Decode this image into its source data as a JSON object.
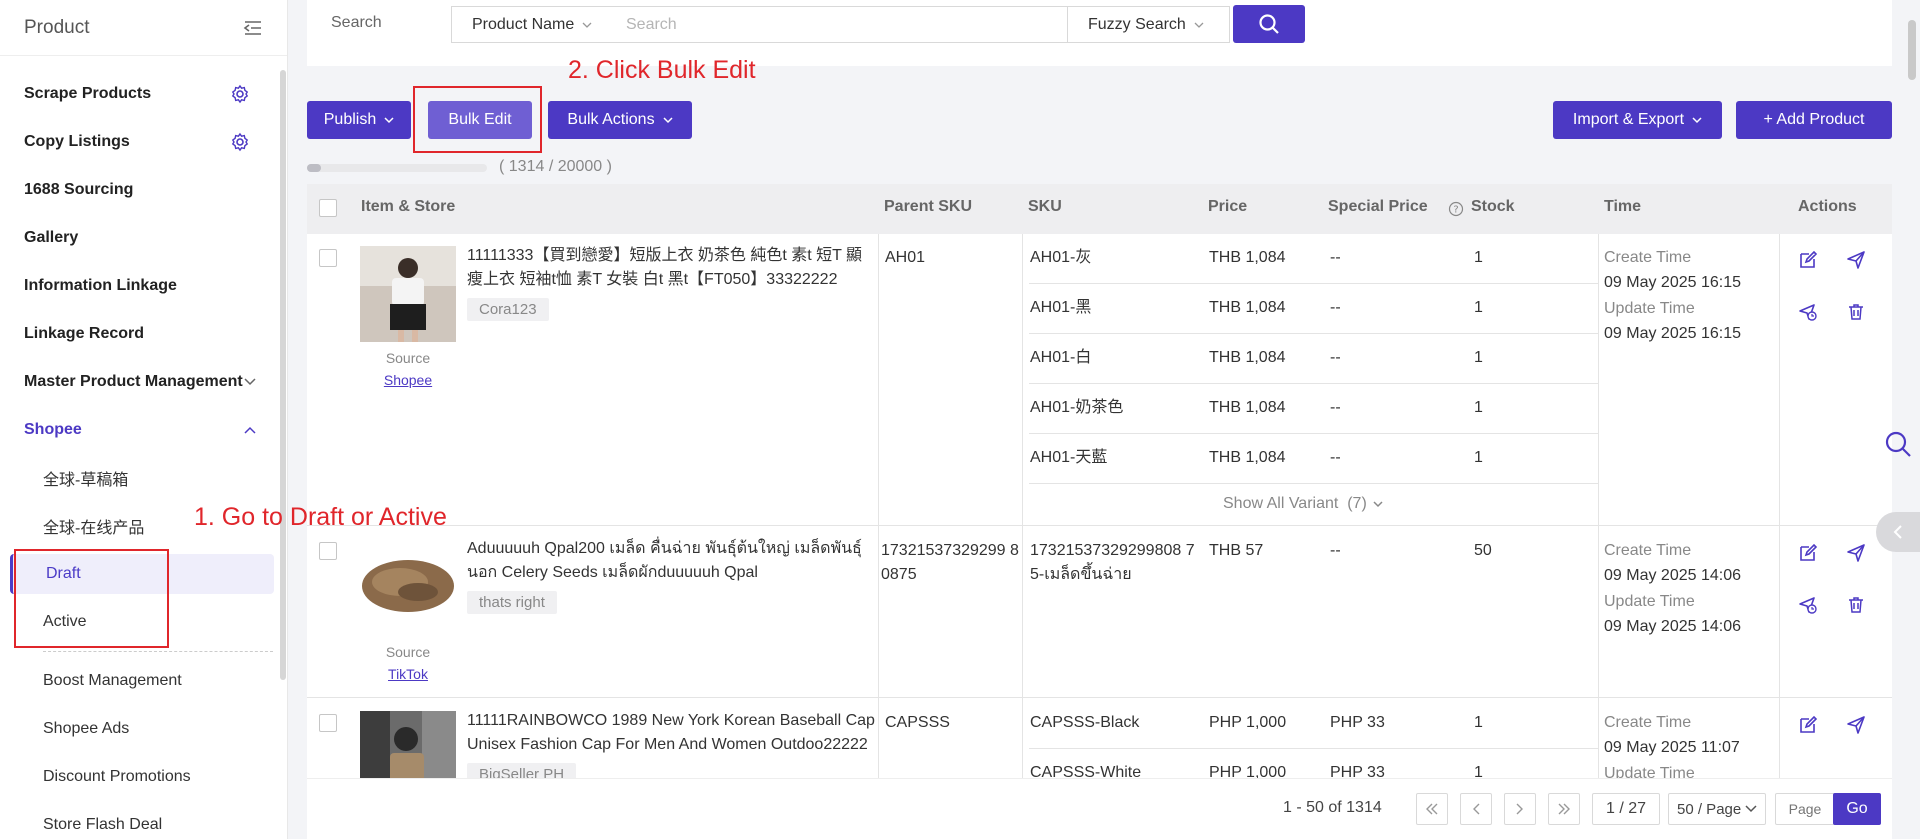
{
  "sidebar": {
    "title": "Product",
    "items": [
      {
        "label": "Scrape Products"
      },
      {
        "label": "Copy Listings"
      },
      {
        "label": "1688 Sourcing"
      },
      {
        "label": "Gallery"
      },
      {
        "label": "Information Linkage"
      },
      {
        "label": "Linkage Record"
      },
      {
        "label": "Master Product Management"
      },
      {
        "label": "Shopee"
      }
    ],
    "shopee_sub": [
      {
        "label": "全球-草稿箱"
      },
      {
        "label": "全球-在线产品"
      },
      {
        "label": "Draft"
      },
      {
        "label": "Active"
      },
      {
        "label": "Boost Management"
      },
      {
        "label": "Shopee Ads"
      },
      {
        "label": "Discount Promotions"
      },
      {
        "label": "Store Flash Deal"
      }
    ]
  },
  "search": {
    "label": "Search",
    "field_select": "Product Name",
    "placeholder": "Search",
    "mode_select": "Fuzzy Search"
  },
  "toolbar": {
    "publish": "Publish",
    "bulk_edit": "Bulk Edit",
    "bulk_actions": "Bulk Actions",
    "import_export": "Import & Export",
    "add_product": "+ Add Product"
  },
  "quota": {
    "text": "( 1314 / 20000 )",
    "used": 1314,
    "total": 20000
  },
  "table": {
    "headers": {
      "item": "Item & Store",
      "parent_sku": "Parent SKU",
      "sku": "SKU",
      "price": "Price",
      "special_price": "Special Price",
      "stock": "Stock",
      "time": "Time",
      "actions": "Actions"
    },
    "rows": [
      {
        "title": "11111333【買到戀愛】短版上衣 奶茶色 純色t 素t 短T 顯瘦上衣 短袖t恤 素T 女裝 白t 黑t【FT050】33322222",
        "store": "Cora123",
        "source_label": "Source",
        "source": "Shopee",
        "parent_sku": "AH01",
        "variants": [
          {
            "sku": "AH01-灰",
            "price": "THB 1,084",
            "special": "--",
            "stock": "1"
          },
          {
            "sku": "AH01-黑",
            "price": "THB 1,084",
            "special": "--",
            "stock": "1"
          },
          {
            "sku": "AH01-白",
            "price": "THB 1,084",
            "special": "--",
            "stock": "1"
          },
          {
            "sku": "AH01-奶茶色",
            "price": "THB 1,084",
            "special": "--",
            "stock": "1"
          },
          {
            "sku": "AH01-天藍",
            "price": "THB 1,084",
            "special": "--",
            "stock": "1"
          }
        ],
        "show_all": "Show All Variant  (7)",
        "create_label": "Create Time",
        "create_time": "09 May 2025 16:15",
        "update_label": "Update Time",
        "update_time": "09 May 2025 16:15"
      },
      {
        "title": "Aduuuuuh Qpal200 เมล็ด คื่นฉ่าย พันธุ์ต้นใหญ่ เมล็ดพันธุ์นอก Celery Seeds เมล็ดผักduuuuuh Qpal",
        "store": "thats right",
        "source_label": "Source",
        "source": "TikTok",
        "parent_sku": "17321537329299 80875",
        "variants": [
          {
            "sku": "17321537329299808 75-เมล็ดขึ้นฉ่าย",
            "price": "THB 57",
            "special": "--",
            "stock": "50"
          }
        ],
        "create_label": "Create Time",
        "create_time": "09 May 2025 14:06",
        "update_label": "Update Time",
        "update_time": "09 May 2025 14:06"
      },
      {
        "title": "11111RAINBOWCO 1989 New York Korean Baseball Cap Unisex Fashion Cap For Men And Women Outdoo22222",
        "store": "BigSeller PH",
        "parent_sku": "CAPSSS",
        "variants": [
          {
            "sku": "CAPSSS-Black",
            "price": "PHP 1,000",
            "special": "PHP 33",
            "stock": "1"
          },
          {
            "sku": "CAPSSS-White",
            "price": "PHP 1,000",
            "special": "PHP 33",
            "stock": "1"
          }
        ],
        "create_label": "Create Time",
        "create_time": "09 May 2025 11:07",
        "update_label": "Update Time"
      }
    ]
  },
  "pagination": {
    "range": "1 - 50 of 1314",
    "current": "1 / 27",
    "per_page": "50 / Page",
    "page_placeholder": "Page",
    "go": "Go"
  },
  "annotations": {
    "step1": "1. Go to Draft or Active",
    "step2": "2. Click Bulk Edit"
  },
  "colors": {
    "accent": "#4c39c4",
    "annotation": "#e0262b"
  }
}
